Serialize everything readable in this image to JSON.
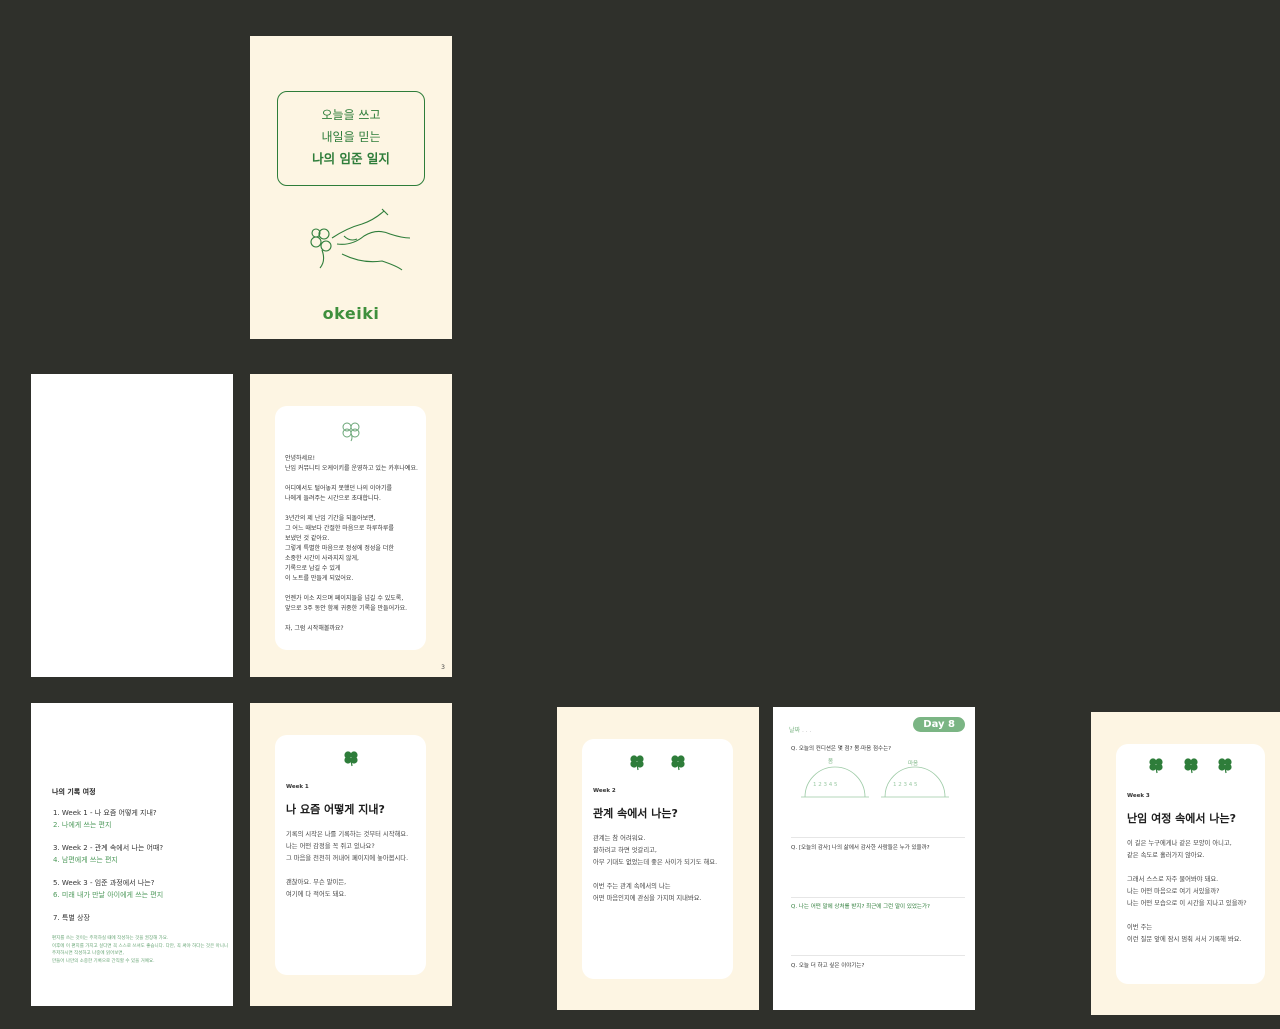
{
  "cover": {
    "line1": "오늘을 쓰고",
    "line2": "내일을 믿는",
    "line3": "나의 임준 일지",
    "logo": "okeiki",
    "icons": [
      "hand-writing-clover-illustration",
      "clover-icon"
    ]
  },
  "intro": {
    "text": "안녕하세요!\n난임 커뮤니티 오케이키를 운영하고 있는 카후나예요.\n\n어디에서도 털어놓지 못했던 나의 이야기를\n나에게 들려주는 시간으로 초대합니다.\n\n3년간의 제 난임 기간을 되돌아보면,\n그 어느 때보다 간절한 마음으로 하루하루를\n보냈던 것 같아요.\n그렇게 특별한 마음으로 정성에 정성을 더한\n소중한 시간이 사라지지 않게,\n기록으로 남길 수 있게\n이 노트를 만들게 되었어요.\n\n언젠가 이소 지으며 페이지들을 넘길 수 있도록,\n앞으로 3주 동안 함께 귀중한 기록을 만들어가요.\n\n자, 그럼 시작해볼까요?",
    "page_number": "3"
  },
  "toc": {
    "title": "나의 기록 여정",
    "items": [
      {
        "label": "1. Week 1 - 나 요즘 어떻게 지내?",
        "color": "dark"
      },
      {
        "label": "2. 나에게 쓰는 편지",
        "color": "green"
      },
      {
        "label": "3. Week 2 - 관계 속에서 나는 어때?",
        "color": "dark"
      },
      {
        "label": "4. 남편에게 쓰는 편지",
        "color": "green"
      },
      {
        "label": "5. Week 3 - 임준 과정에서 나는?",
        "color": "dark"
      },
      {
        "label": "6. 미래 내가 만날 아이에게 쓰는 편지",
        "color": "green"
      },
      {
        "label": "7. 특별 상장",
        "color": "dark"
      }
    ],
    "note": "편지를 쓰는 것이는 주저하실 때에 작성하는 것을 권장해 가요.\n이후에 이 편지를 가지고 싶다면 꼭 스스로 쓰셔도 좋습니다. 다만, 꼭 써야 하다는 것은 아니니\n주저하시면 작성하고 나중에 읽어보면,\n만들어 나만의 소중한 기록으로 간직할 수 있을 거예요."
  },
  "week1": {
    "label": "Week 1",
    "title": "나 요즘 어떻게 지내?",
    "body": "기록의 시작은 나를 기록하는 것부터 시작해요.\n나는 어떤 감정을 꼭 쥐고 있나요?\n그 마음을 천천히 꺼내어 페이지에 놓아봅시다.\n\n괜찮아요. 무슨 말이든,\n여기에 다 적어도 돼요."
  },
  "week2": {
    "label": "Week 2",
    "title": "관계 속에서 나는?",
    "body": "관계는 참 어려워요.\n잘하려고 하면 엇갈리고,\n아무 기대도 없었는데 좋은 사이가 되기도 해요.\n\n이번 주는 관계 속에서의 나는\n어떤 마음인지에 관심을 가지며 지내봐요."
  },
  "day8": {
    "badge": "Day 8",
    "date_label": "날짜",
    "date_dots": ".       .       .",
    "q1": "Q. 오늘의 컨디션은 몇 점?   몸·마음 점수는?",
    "gauge_body": "몸",
    "gauge_mind": "마음",
    "gauge_nums": "1 2 3 4 5",
    "q2": "Q. [오늘의 감사] 나의 삶에서 감사한 사람들은 누가 있을까?",
    "q3": "Q. 나는 어떤 말에 상처를 받지? 최근에 그런 말이 있었는가?",
    "q4": "Q. 오늘 더 하고 싶은 이야기는?"
  },
  "week3": {
    "label": "Week 3",
    "title": "난임 여정 속에서 나는?",
    "body": "이 길은 누구에게나 같은 모양이 아니고,\n같은 속도로 흘러가지 않아요.\n\n그래서 스스로 자주 물어봐야 돼요.\n나는 어떤 마음으로 여기 서있을까?\n나는 어떤 모습으로 이 시간을 지나고 있을까?\n\n이번 주는\n이런 질문 앞에 잠시 멈춰 서서 기록해 봐요."
  },
  "colors": {
    "background": "#2f302b",
    "page": "#fdf5e3",
    "accent_green": "#2e7d3a",
    "light_green": "#7bb584"
  }
}
